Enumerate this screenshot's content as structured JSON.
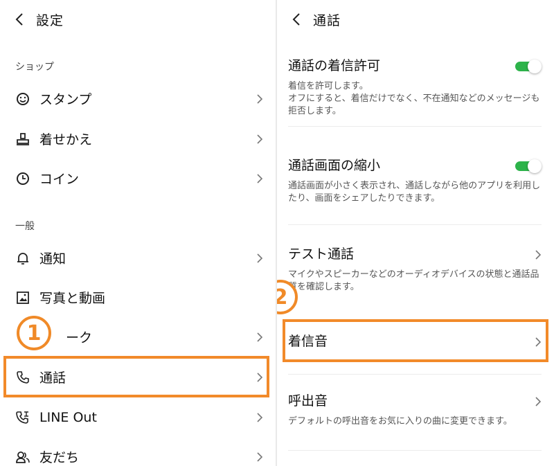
{
  "left": {
    "header": {
      "title": "設定"
    },
    "sections": {
      "shop": "ショップ",
      "general": "一般"
    },
    "items": [
      {
        "label": "スタンプ",
        "icon": "smiley-icon"
      },
      {
        "label": "着せかえ",
        "icon": "stamp-icon"
      },
      {
        "label": "コイン",
        "icon": "clock-coin-icon"
      },
      {
        "label": "通知",
        "icon": "bell-icon"
      },
      {
        "label": "写真と動画",
        "icon": "image-icon"
      },
      {
        "label": "ーク",
        "icon": "chat-icon"
      },
      {
        "label": "通話",
        "icon": "phone-icon"
      },
      {
        "label": "LINE Out",
        "icon": "phone-out-icon"
      },
      {
        "label": "友だち",
        "icon": "friends-icon"
      }
    ]
  },
  "right": {
    "header": {
      "title": "通話"
    },
    "items": [
      {
        "title": "通話の着信許可",
        "desc": "着信を許可します。\nオフにすると、着信だけでなく、不在通知などのメッセージも拒否します。",
        "toggle": true
      },
      {
        "title": "通話画面の縮小",
        "desc": "通話画面が小さく表示され、通話しながら他のアプリを利用したり、画面をシェアしたりできます。",
        "toggle": true
      },
      {
        "title": "テスト通話",
        "desc": "マイクやスピーカーなどのオーディオデバイスの状態と通話品質を確認します。"
      },
      {
        "title": "着信音",
        "desc": ""
      },
      {
        "title": "呼出音",
        "desc": "デフォルトの呼出音をお気に入りの曲に変更できます。"
      }
    ]
  },
  "callouts": {
    "one": "1",
    "two": "2"
  },
  "colors": {
    "accent": "#f28a2a",
    "toggle_on": "#2db34a"
  }
}
